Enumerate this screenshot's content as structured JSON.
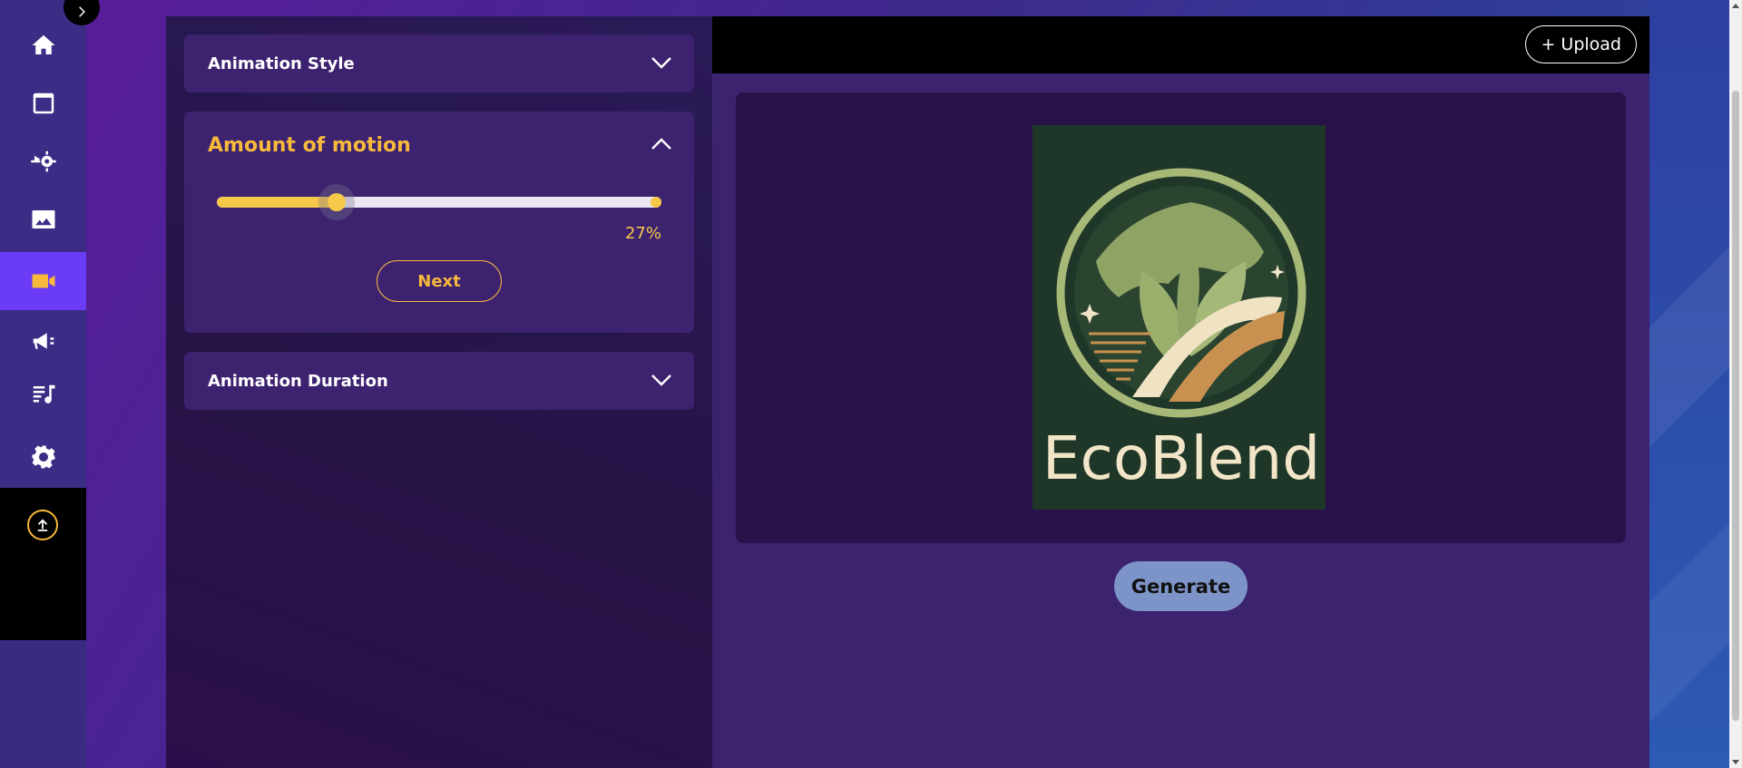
{
  "sidebar": {
    "items": [
      {
        "name": "home",
        "icon": "home-icon"
      },
      {
        "name": "notes",
        "icon": "document-icon"
      },
      {
        "name": "automation",
        "icon": "workflow-gear-icon"
      },
      {
        "name": "images",
        "icon": "image-icon"
      },
      {
        "name": "video",
        "icon": "video-camera-icon",
        "active": true
      },
      {
        "name": "marketing",
        "icon": "megaphone-icon"
      },
      {
        "name": "audio",
        "icon": "music-note-icon"
      },
      {
        "name": "settings",
        "icon": "gear-icon"
      }
    ],
    "upload_icon": "upload-arrow-icon",
    "collapse_icon": "chevron-right-icon"
  },
  "left_panel": {
    "animation_style": {
      "title": "Animation Style",
      "expanded": false
    },
    "amount_of_motion": {
      "title": "Amount of motion",
      "expanded": true,
      "slider_value_percent": 27,
      "slider_label": "27%",
      "next_label": "Next"
    },
    "animation_duration": {
      "title": "Animation Duration",
      "expanded": false
    }
  },
  "right_panel": {
    "upload_label": "+ Upload",
    "preview_image": {
      "brand_text": "EcoBlend"
    },
    "generate_label": "Generate"
  },
  "colors": {
    "accent": "#f6b93b",
    "active_nav": "#6a3cf5",
    "panel_bg": "#3d2270",
    "generate_btn": "#7c94c8"
  }
}
